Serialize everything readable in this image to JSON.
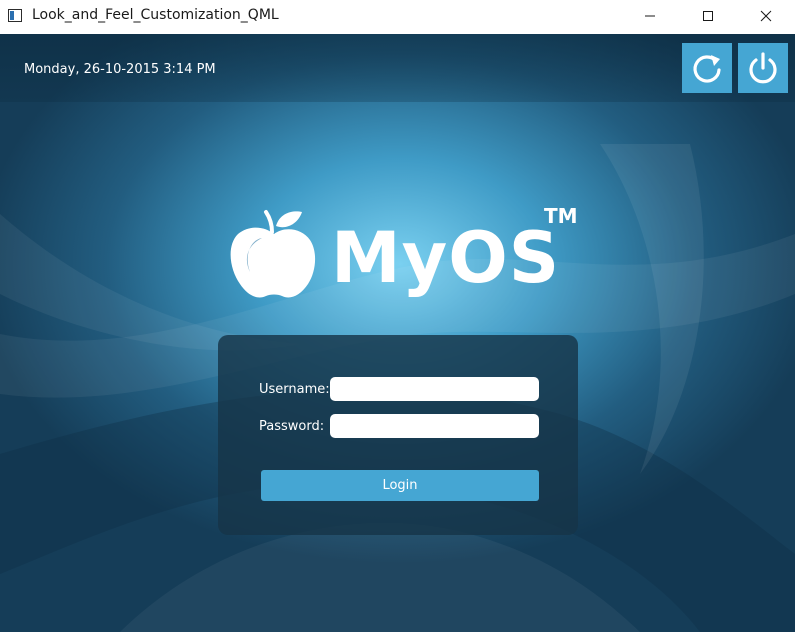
{
  "window": {
    "title": "Look_and_Feel_Customization_QML"
  },
  "header": {
    "datetime": "Monday, 26-10-2015 3:14 PM",
    "restart_icon": "restart-icon",
    "power_icon": "power-icon"
  },
  "logo": {
    "icon": "apple-icon",
    "text": "MyOS",
    "trademark": "TM"
  },
  "login": {
    "username_label": "Username:",
    "username_value": "",
    "password_label": "Password:",
    "password_value": "",
    "button_label": "Login"
  },
  "colors": {
    "accent": "#45a6d3",
    "panel": "#163448",
    "background": "#225d80"
  }
}
